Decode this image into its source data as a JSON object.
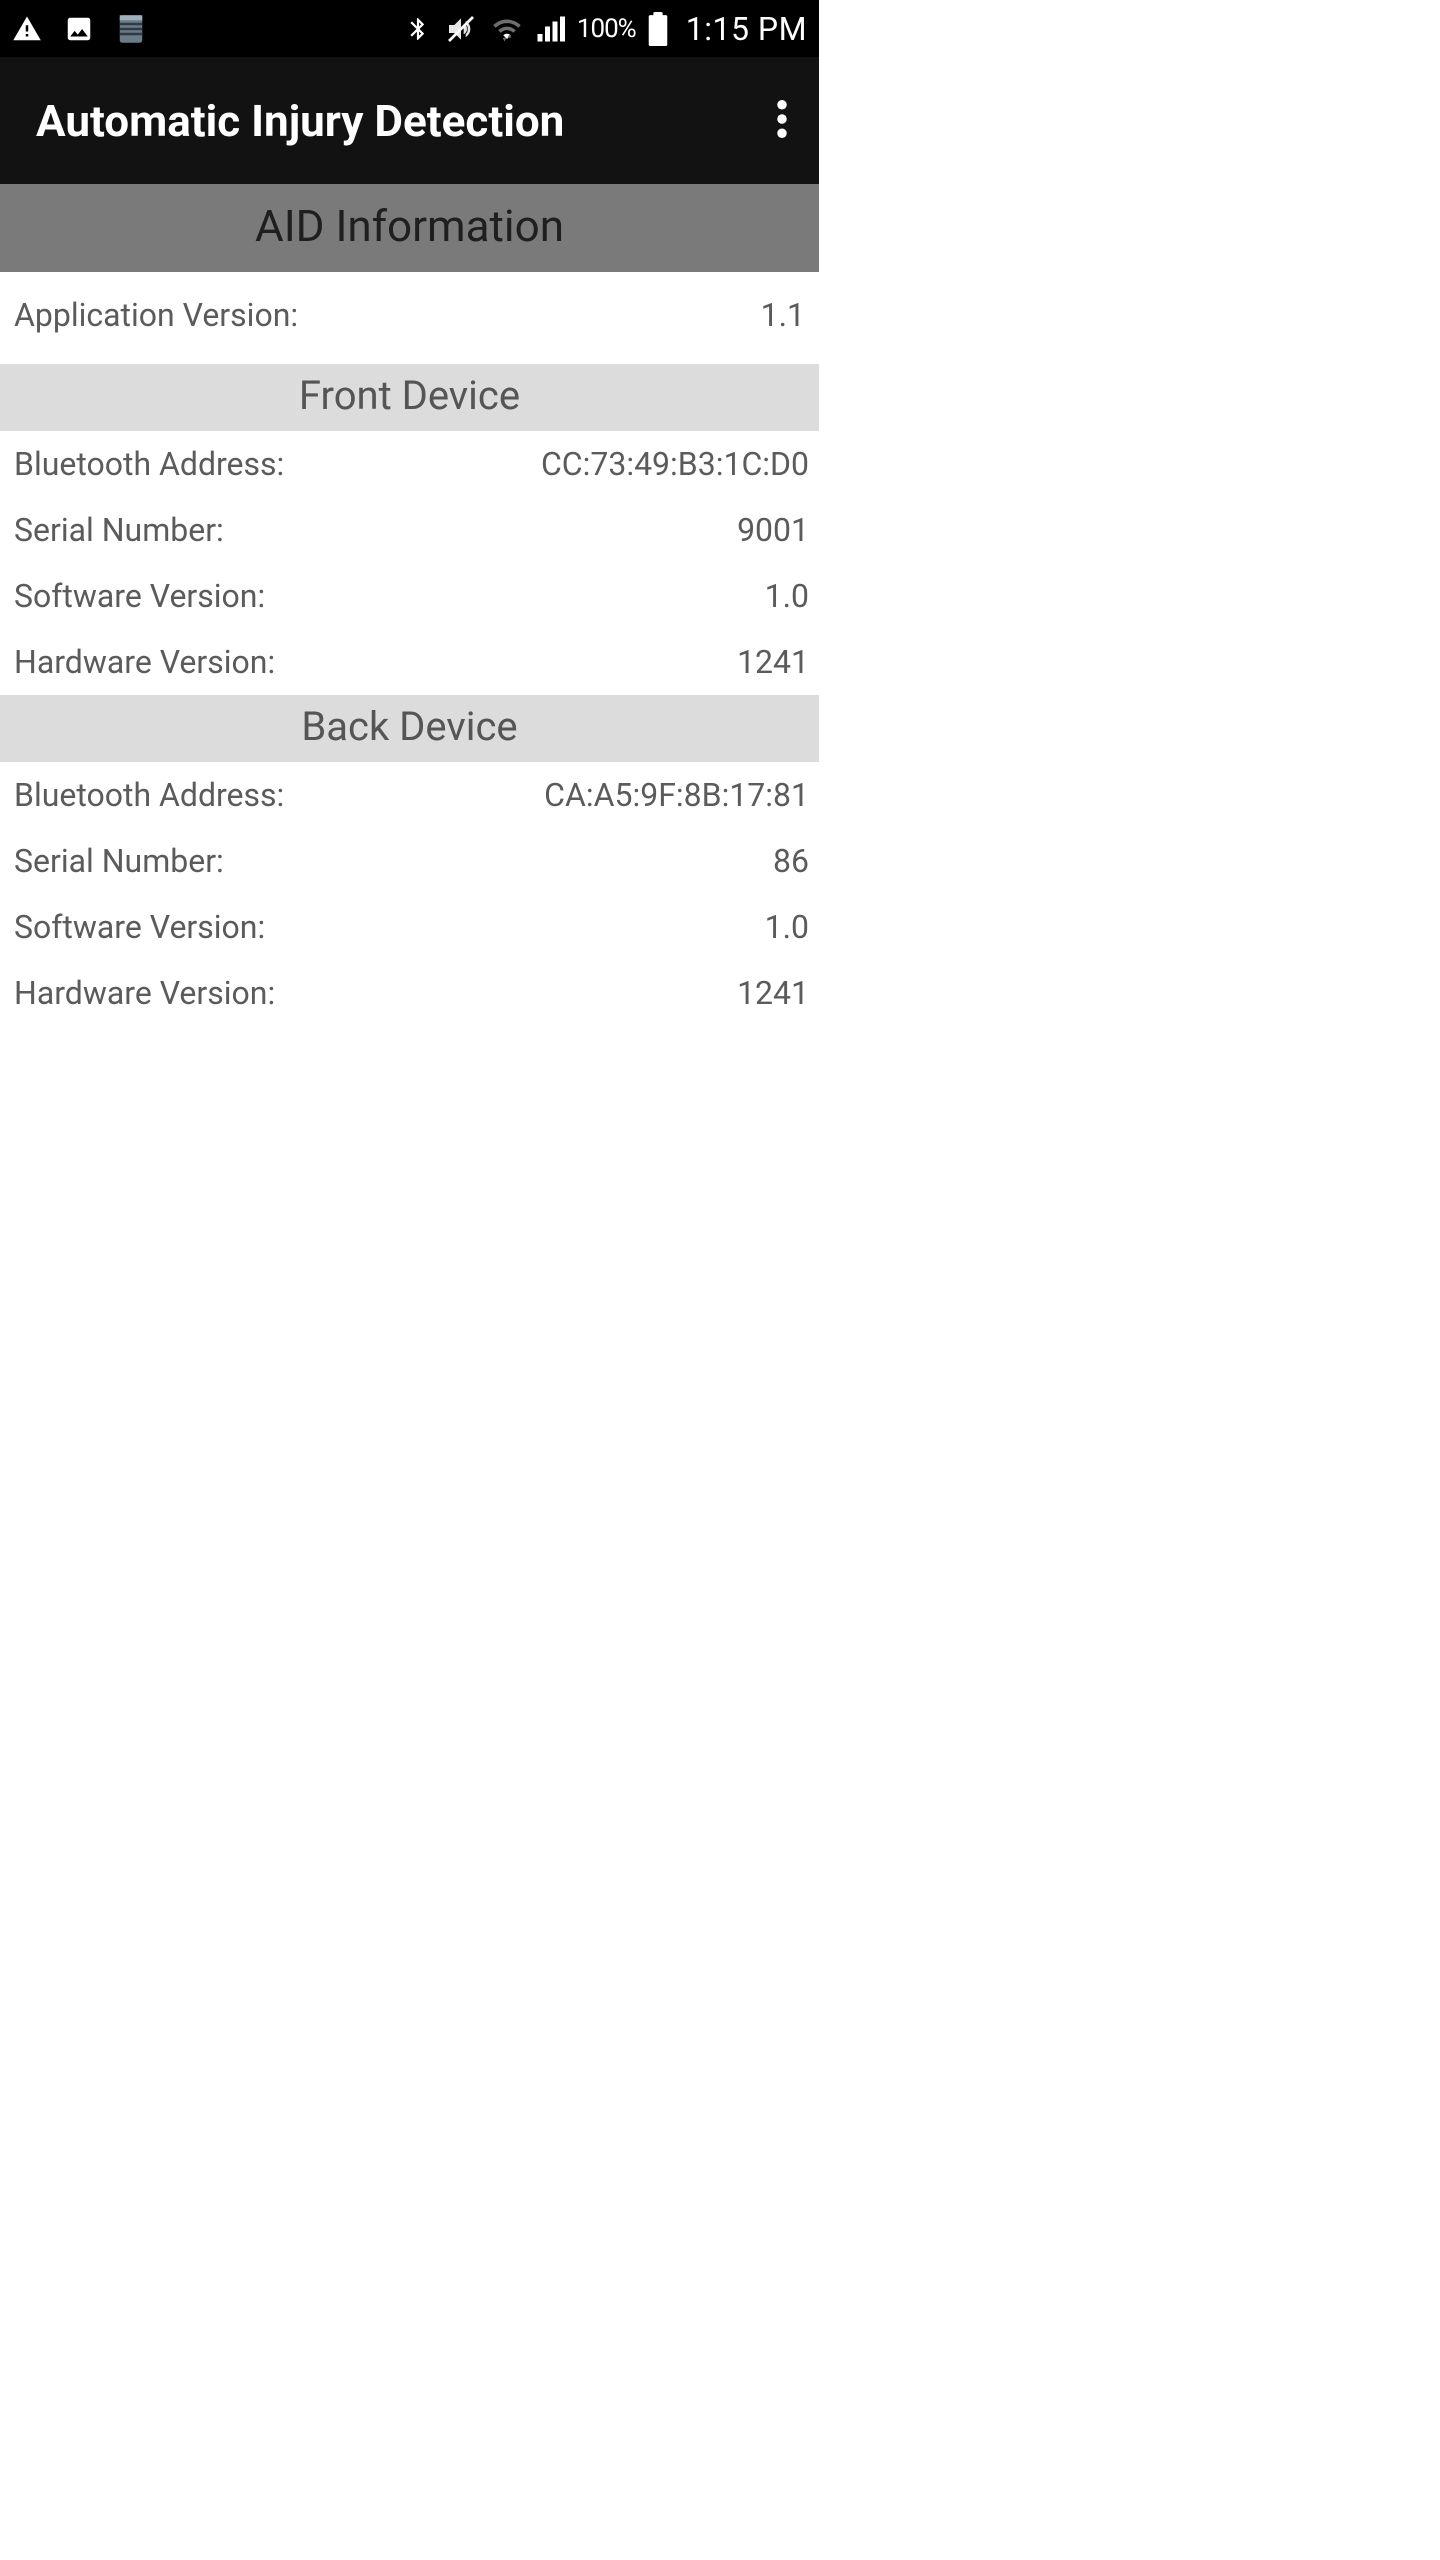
{
  "status_bar": {
    "battery_percent": "100%",
    "clock": "1:15 PM"
  },
  "app_bar": {
    "title": "Automatic Injury Detection"
  },
  "sections": {
    "aid_info_header": "AID Information",
    "app_version_label": "Application Version:",
    "app_version_value": "1.1",
    "front_header": "Front Device",
    "front": {
      "bt_label": "Bluetooth Address:",
      "bt_value": "CC:73:49:B3:1C:D0",
      "serial_label": "Serial Number:",
      "serial_value": "9001",
      "sw_label": "Software Version:",
      "sw_value": "1.0",
      "hw_label": "Hardware Version:",
      "hw_value": "1241"
    },
    "back_header": "Back Device",
    "back": {
      "bt_label": "Bluetooth Address:",
      "bt_value": "CA:A5:9F:8B:17:81",
      "serial_label": "Serial Number:",
      "serial_value": "86",
      "sw_label": "Software Version:",
      "sw_value": "1.0",
      "hw_label": "Hardware Version:",
      "hw_value": "1241"
    }
  }
}
